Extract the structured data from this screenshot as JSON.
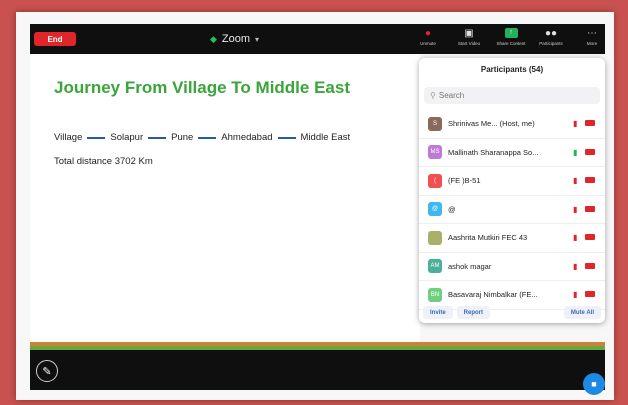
{
  "toolbar": {
    "end_label": "End",
    "meeting_title": "Zoom",
    "items": [
      {
        "label": "Unmute",
        "icon": "microphone-muted-icon"
      },
      {
        "label": "Start Video",
        "icon": "video-off-icon"
      },
      {
        "label": "Share Content",
        "icon": "share-screen-icon"
      },
      {
        "label": "Participants",
        "icon": "participants-icon"
      },
      {
        "label": "More",
        "icon": "more-icon"
      }
    ]
  },
  "slide": {
    "title": "Journey From Village To Middle East",
    "route": [
      "Village",
      "Solapur",
      "Pune",
      "Ahmedabad",
      "Middle East"
    ],
    "distance": "Total distance 3702 Km"
  },
  "participants_panel": {
    "title": "Participants (54)",
    "search_placeholder": "Search",
    "participants": [
      {
        "initials": "S",
        "name": "Shrinivas Me... (Host, me)",
        "avatar_color": "#8a6a5a",
        "mic": "muted"
      },
      {
        "initials": "MS",
        "name": "Mallinath Sharanappa So...",
        "avatar_color": "#c07ad6",
        "mic": "on"
      },
      {
        "initials": "(",
        "name": "(FE )B-51",
        "avatar_color": "#f05050",
        "mic": "muted"
      },
      {
        "initials": "@",
        "name": "@",
        "avatar_color": "#3fb8f0",
        "mic": "muted"
      },
      {
        "initials": "",
        "name": "Aashrita Mutkiri FEC 43",
        "avatar_color": "#a8b06a",
        "mic": "muted"
      },
      {
        "initials": "AM",
        "name": "ashok magar",
        "avatar_color": "#4caf9a",
        "mic": "muted"
      },
      {
        "initials": "BN",
        "name": "Basavaraj Nimbalkar (FE...",
        "avatar_color": "#6fcf7f",
        "mic": "muted"
      }
    ],
    "invite_label": "Invite",
    "report_label": "Report",
    "mute_all_label": "Mute All"
  },
  "colors": {
    "background": "#c9514f",
    "end_button": "#e0262a",
    "slide_title": "#3aa53a",
    "route_dash": "#2a57a8",
    "share_button": "#25b15c"
  }
}
